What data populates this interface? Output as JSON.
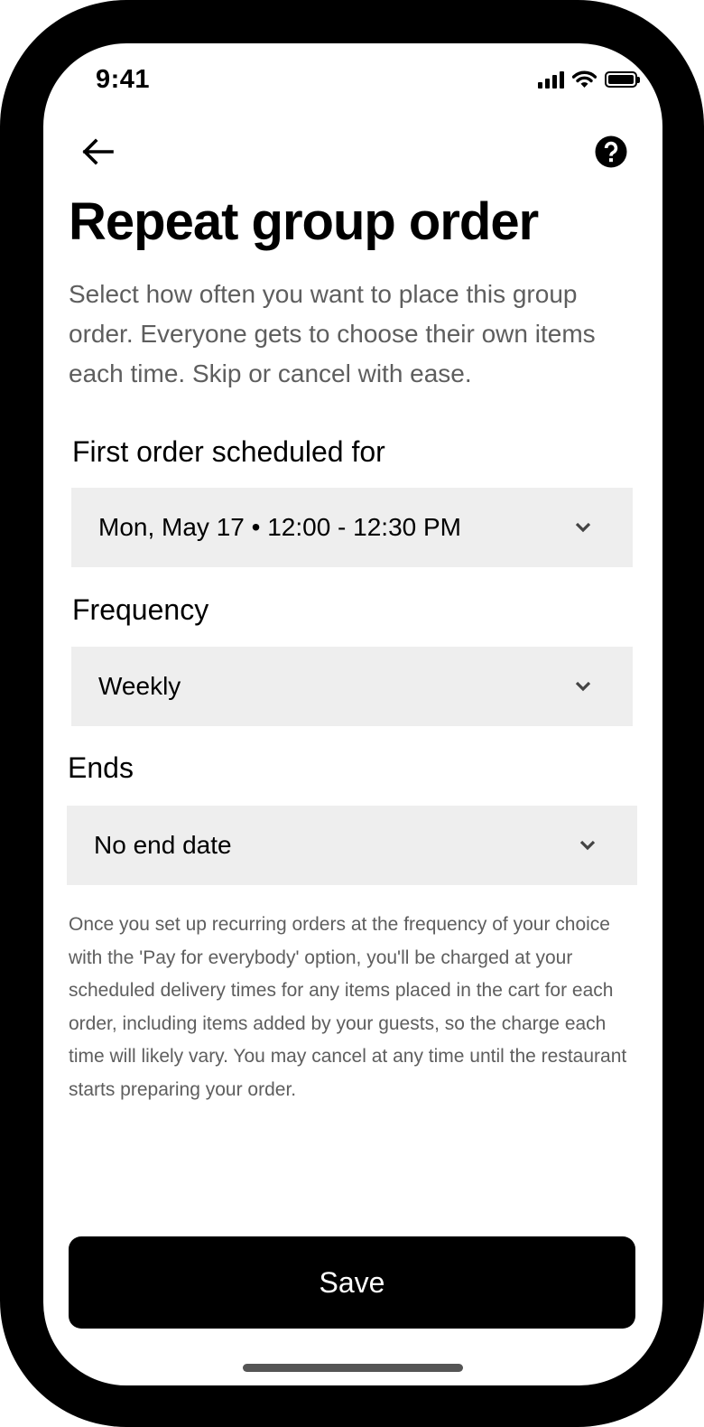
{
  "status_bar": {
    "time": "9:41",
    "icons": [
      "signal-icon",
      "wifi-icon",
      "battery-icon"
    ]
  },
  "nav": {
    "back_icon": "arrow-left-icon",
    "help_icon": "question-circle-icon"
  },
  "header": {
    "title": "Repeat group order",
    "subtitle": "Select how often you want to place this group order.  Everyone gets to choose their own items each time. Skip or cancel with ease."
  },
  "fields": {
    "first_order": {
      "label": "First order scheduled for",
      "value": "Mon, May 17 • 12:00 - 12:30 PM"
    },
    "frequency": {
      "label": "Frequency",
      "value": "Weekly"
    },
    "ends": {
      "label": "Ends",
      "value": "No end date"
    }
  },
  "disclaimer": "Once you set up recurring orders at the frequency of your choice with the 'Pay for everybody' option, you'll be charged at your scheduled delivery times for any items placed in the cart for each order, including items added by your guests, so the charge each time will likely vary. You may cancel at any time until the restaurant starts preparing your order.",
  "actions": {
    "save_label": "Save"
  },
  "colors": {
    "primary": "#000000",
    "field_background": "#eeeeee",
    "secondary_text": "#5e5e5e",
    "background": "#ffffff"
  }
}
